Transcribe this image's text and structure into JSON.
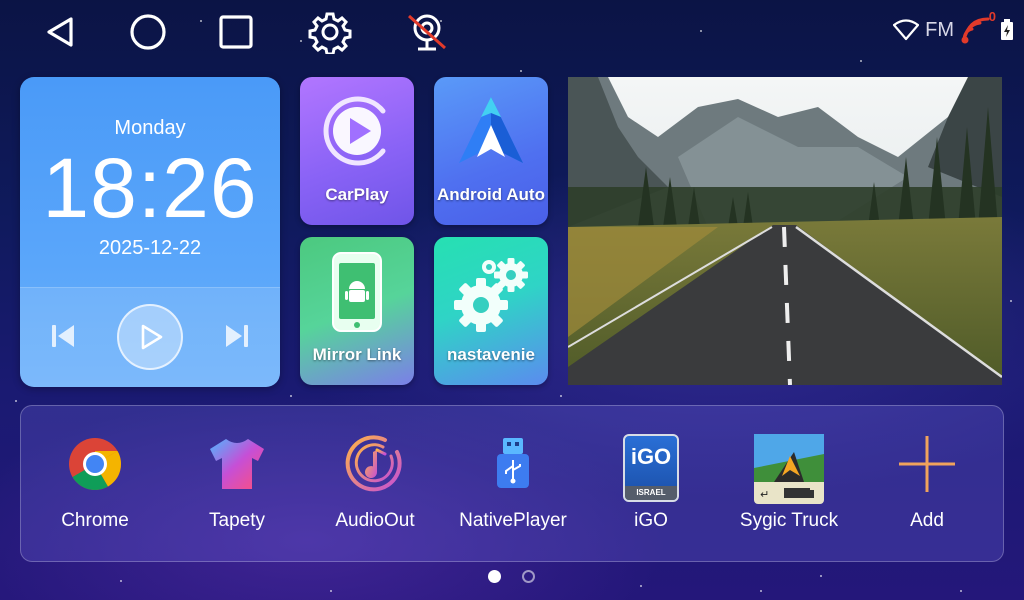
{
  "colors": {
    "background": "#0f1a5c",
    "clock_card": "#5aa6fa",
    "carplay_tile": "#8a63f6",
    "android_auto_tile": "#5a7cf6",
    "mirror_link_tile": "#56d49a",
    "settings_tile": "#2fd4c6",
    "dock": "#4a3fb4",
    "signal_red": "#e23a2a"
  },
  "topbar": {
    "icons": [
      "back-icon",
      "home-icon",
      "recent-apps-icon",
      "settings-icon",
      "camera-disabled-icon"
    ],
    "status": {
      "fm_label": "FM",
      "signal_badge": "0",
      "icons": [
        "wifi-icon",
        "signal-icon",
        "battery-icon"
      ]
    }
  },
  "clock": {
    "day": "Monday",
    "time": "18:26",
    "date": "2025-12-22"
  },
  "player": {
    "icons": [
      "previous-icon",
      "play-icon",
      "next-icon"
    ]
  },
  "tiles": [
    {
      "label": "CarPlay",
      "icon": "carplay-icon"
    },
    {
      "label": "Android Auto",
      "icon": "android-auto-icon"
    },
    {
      "label": "Mirror Link",
      "icon": "mirror-link-icon"
    },
    {
      "label": "nastavenie",
      "icon": "gears-icon"
    }
  ],
  "dock": [
    {
      "label": "Chrome",
      "icon": "chrome-icon"
    },
    {
      "label": "Tapety",
      "icon": "tshirt-icon"
    },
    {
      "label": "AudioOut",
      "icon": "music-disc-icon"
    },
    {
      "label": "NativePlayer",
      "icon": "usb-icon"
    },
    {
      "label": "iGO",
      "icon": "igo-icon",
      "badge_text": "iGO",
      "badge_sub": "ISRAEL"
    },
    {
      "label": "Sygic Truck",
      "icon": "sygic-icon"
    },
    {
      "label": "Add",
      "icon": "plus-icon"
    }
  ],
  "pagination": {
    "pages": 2,
    "current": 1
  }
}
